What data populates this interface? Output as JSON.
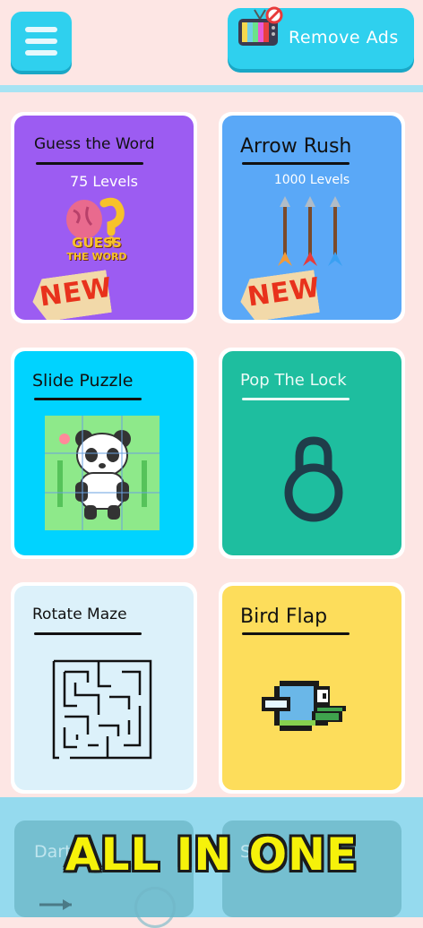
{
  "header": {
    "menu_icon": "hamburger-menu-icon",
    "remove_ads_label": "Remove Ads",
    "ads_icon": "no-ads-tv-icon"
  },
  "games": [
    {
      "title": "Guess the Word",
      "subtitle": "75 Levels",
      "badge": "NEW",
      "logo_text_line1": "GUESS",
      "logo_text_line2": "THE WORD",
      "color": "#9c5cf2"
    },
    {
      "title": "Arrow Rush",
      "subtitle": "1000 Levels",
      "badge": "NEW",
      "color": "#5aa8f7"
    },
    {
      "title": "Slide Puzzle",
      "color": "#00d3ff"
    },
    {
      "title": "Pop The Lock",
      "color": "#1ebe9f"
    },
    {
      "title": "Rotate Maze",
      "color": "#dcf1fa"
    },
    {
      "title": "Bird Flap",
      "color": "#fddd5b"
    },
    {
      "title": "Dart B",
      "partially_hidden": true
    },
    {
      "title": "S",
      "partially_hidden_right": "D"
    }
  ],
  "banner": {
    "text": "ALL IN ONE"
  }
}
